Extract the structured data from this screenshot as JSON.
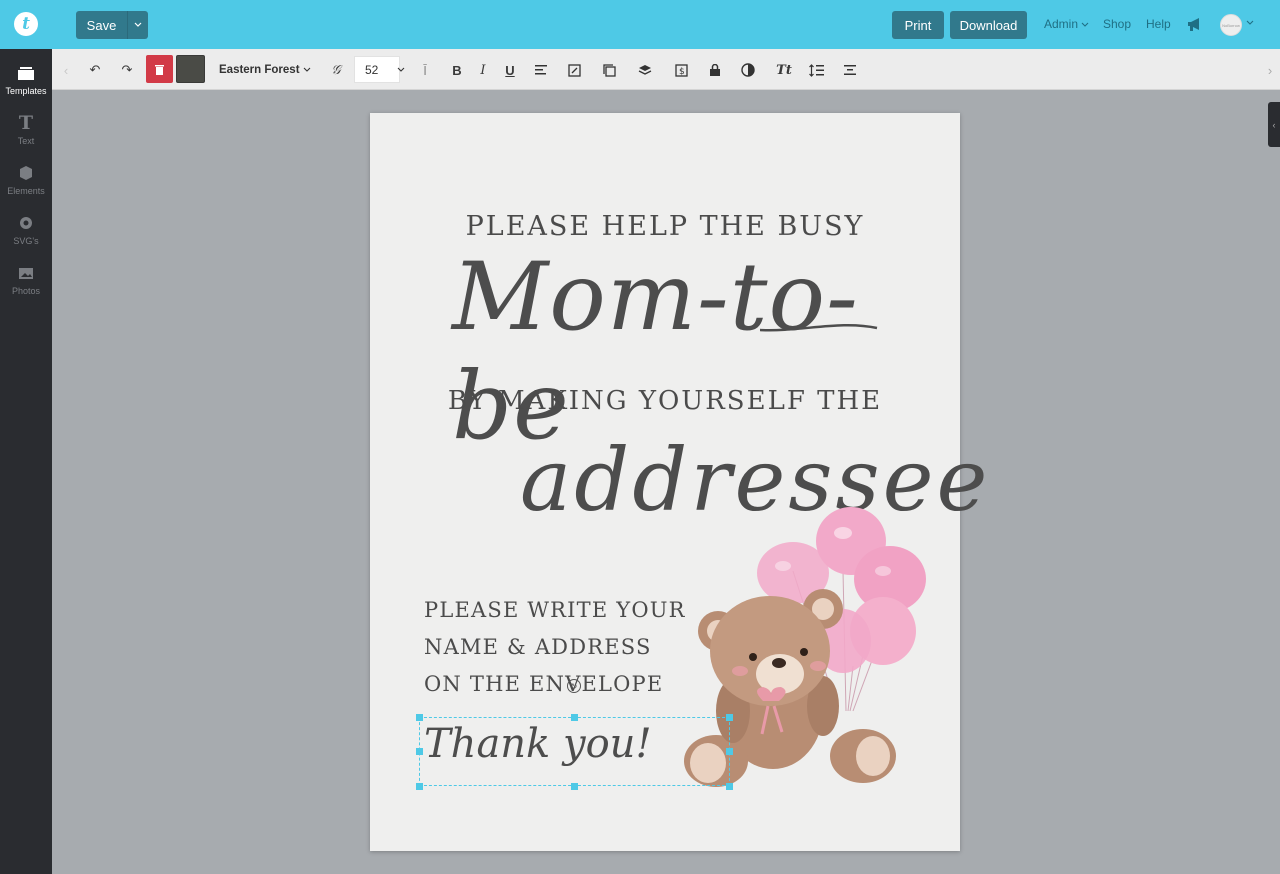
{
  "app": {
    "logo_letter": "t"
  },
  "header": {
    "save_label": "Save",
    "print_label": "Print",
    "download_label": "Download",
    "admin_label": "Admin",
    "shop_label": "Shop",
    "help_label": "Help",
    "avatar_text": "NoBorrow"
  },
  "sidebar": {
    "items": [
      {
        "label": "Templates",
        "icon": "templates-icon",
        "active": true
      },
      {
        "label": "Text",
        "icon": "text-icon"
      },
      {
        "label": "Elements",
        "icon": "elements-icon"
      },
      {
        "label": "SVG's",
        "icon": "svg-icon"
      },
      {
        "label": "Photos",
        "icon": "photos-icon"
      }
    ]
  },
  "toolbar": {
    "font_name": "Eastern Forest",
    "font_size": "52",
    "text_color": "#4a4b46",
    "delete_color": "#d23a47"
  },
  "design": {
    "line1": "PLEASE HELP THE BUSY",
    "script1": "Mom-to-be",
    "line2": "BY MAKING YOURSELF THE",
    "script2": "addressee",
    "instr1": "PLEASE WRITE YOUR",
    "instr2": "NAME & ADDRESS",
    "instr3": "ON THE ENVELOPE",
    "thanks": "Thank you!"
  },
  "colors": {
    "topbar": "#4ec9e6",
    "button": "#31798c",
    "sidebar": "#2a2c30",
    "selection": "#4ec9e6",
    "balloon": "#f2a9c9"
  }
}
